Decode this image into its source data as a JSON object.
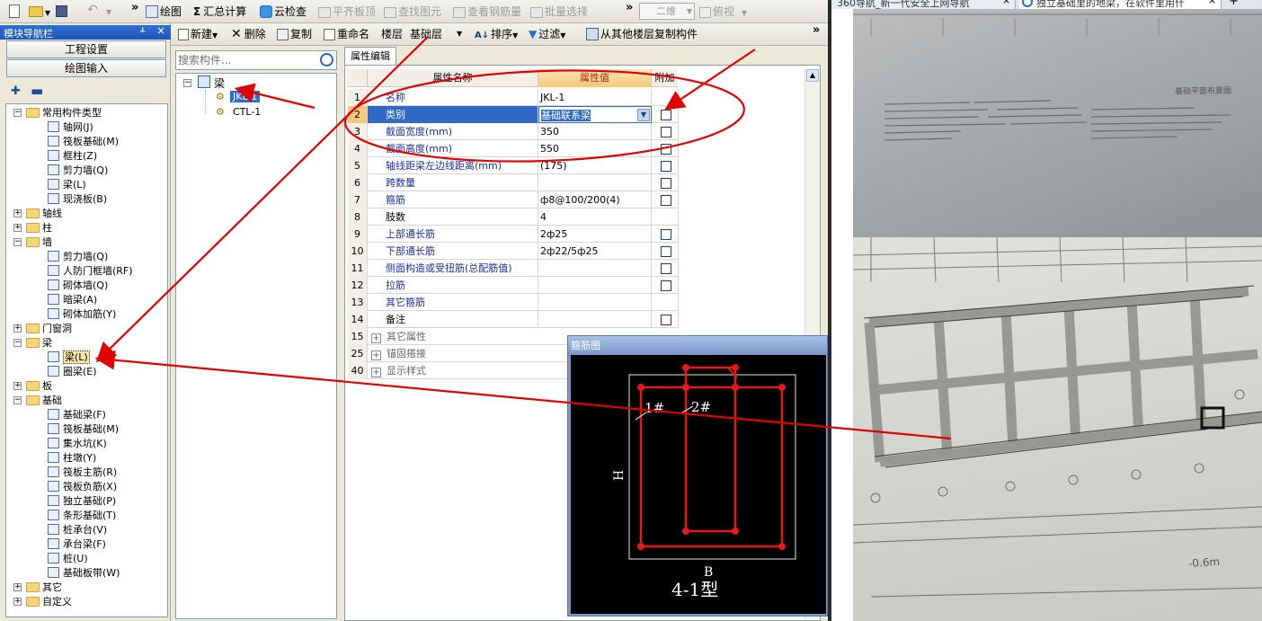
{
  "toolbar1": {
    "draw": "绘图",
    "sum": "汇总计算",
    "cloud_check": "云检查",
    "flat_top": "平齐板顶",
    "find": "查找图元",
    "view_rebar": "查看钢筋量",
    "batch": "批量选择",
    "view_mode": "二维",
    "perspective": "俯视",
    "chevron": "»"
  },
  "nav": {
    "title": "模块导航栏",
    "project_settings": "工程设置",
    "draw_input": "绘图输入",
    "tree": [
      {
        "label": "常用构件类型",
        "type": "folder",
        "expanded": true,
        "level": 0
      },
      {
        "label": "轴网(J)",
        "type": "item",
        "level": 1
      },
      {
        "label": "筏板基础(M)",
        "type": "item",
        "level": 1
      },
      {
        "label": "框柱(Z)",
        "type": "item",
        "level": 1
      },
      {
        "label": "剪力墙(Q)",
        "type": "item",
        "level": 1
      },
      {
        "label": "梁(L)",
        "type": "item",
        "level": 1
      },
      {
        "label": "现浇板(B)",
        "type": "item",
        "level": 1
      },
      {
        "label": "轴线",
        "type": "folder",
        "expanded": false,
        "level": 0
      },
      {
        "label": "柱",
        "type": "folder",
        "expanded": false,
        "level": 0
      },
      {
        "label": "墙",
        "type": "folder",
        "expanded": true,
        "level": 0
      },
      {
        "label": "剪力墙(Q)",
        "type": "item",
        "level": 1
      },
      {
        "label": "人防门框墙(RF)",
        "type": "item",
        "level": 1
      },
      {
        "label": "砌体墙(Q)",
        "type": "item",
        "level": 1
      },
      {
        "label": "暗梁(A)",
        "type": "item",
        "level": 1
      },
      {
        "label": "砌体加筋(Y)",
        "type": "item",
        "level": 1
      },
      {
        "label": "门窗洞",
        "type": "folder",
        "expanded": false,
        "level": 0
      },
      {
        "label": "梁",
        "type": "folder",
        "expanded": true,
        "level": 0
      },
      {
        "label": "梁(L)",
        "type": "item",
        "level": 1,
        "selected": true
      },
      {
        "label": "圈梁(E)",
        "type": "item",
        "level": 1
      },
      {
        "label": "板",
        "type": "folder",
        "expanded": false,
        "level": 0
      },
      {
        "label": "基础",
        "type": "folder",
        "expanded": true,
        "level": 0
      },
      {
        "label": "基础梁(F)",
        "type": "item",
        "level": 1
      },
      {
        "label": "筏板基础(M)",
        "type": "item",
        "level": 1
      },
      {
        "label": "集水坑(K)",
        "type": "item",
        "level": 1
      },
      {
        "label": "柱墩(Y)",
        "type": "item",
        "level": 1
      },
      {
        "label": "筏板主筋(R)",
        "type": "item",
        "level": 1
      },
      {
        "label": "筏板负筋(X)",
        "type": "item",
        "level": 1
      },
      {
        "label": "独立基础(P)",
        "type": "item",
        "level": 1
      },
      {
        "label": "条形基础(T)",
        "type": "item",
        "level": 1
      },
      {
        "label": "桩承台(V)",
        "type": "item",
        "level": 1
      },
      {
        "label": "承台梁(F)",
        "type": "item",
        "level": 1
      },
      {
        "label": "桩(U)",
        "type": "item",
        "level": 1
      },
      {
        "label": "基础板带(W)",
        "type": "item",
        "level": 1
      },
      {
        "label": "其它",
        "type": "folder",
        "expanded": false,
        "level": 0
      },
      {
        "label": "自定义",
        "type": "folder",
        "expanded": false,
        "level": 0
      }
    ]
  },
  "toolbar2": {
    "new": "新建",
    "delete": "删除",
    "copy": "复制",
    "rename": "重命名",
    "floor_label": "楼层",
    "floor_value": "基础层",
    "sort": "排序",
    "filter": "过滤",
    "copy_from_floor": "从其他楼层复制构件",
    "chevron": "»"
  },
  "component_list": {
    "search_placeholder": "搜索构件...",
    "root": "梁",
    "items": [
      "JKL-1",
      "CTL-1"
    ]
  },
  "property_editor": {
    "tab": "属性编辑",
    "col_name": "属性名称",
    "col_value": "属性值",
    "col_extra": "附加",
    "rows": [
      {
        "no": "1",
        "name": "名称",
        "value": "JKL-1",
        "check": false
      },
      {
        "no": "2",
        "name": "类别",
        "value": "基础联系梁",
        "check": true
      },
      {
        "no": "3",
        "name": "截面宽度(mm)",
        "value": "350",
        "check": true
      },
      {
        "no": "4",
        "name": "截面高度(mm)",
        "value": "550",
        "check": true
      },
      {
        "no": "5",
        "name": "轴线距梁左边线距离(mm)",
        "value": "(175)",
        "check": true
      },
      {
        "no": "6",
        "name": "跨数量",
        "value": "",
        "check": true
      },
      {
        "no": "7",
        "name": "箍筋",
        "value": "ф8@100/200(4)",
        "check": true
      },
      {
        "no": "8",
        "name": "肢数",
        "value": "4",
        "check": false
      },
      {
        "no": "9",
        "name": "上部通长筋",
        "value": "2ф25",
        "check": true
      },
      {
        "no": "10",
        "name": "下部通长筋",
        "value": "2ф22/5ф25",
        "check": true
      },
      {
        "no": "11",
        "name": "侧面构造或受扭筋(总配筋值)",
        "value": "",
        "check": true
      },
      {
        "no": "12",
        "name": "拉筋",
        "value": "",
        "check": true
      },
      {
        "no": "13",
        "name": "其它箍筋",
        "value": "",
        "check": false
      },
      {
        "no": "14",
        "name": "备注",
        "value": "",
        "check": true
      },
      {
        "no": "15",
        "name": "其它属性",
        "value": "",
        "group": true
      },
      {
        "no": "25",
        "name": "锚固搭接",
        "value": "",
        "group": true
      },
      {
        "no": "40",
        "name": "显示样式",
        "value": "",
        "group": true
      }
    ]
  },
  "stirrup_popup": {
    "title": "箍筋图",
    "label1": "1#",
    "label2": "2#",
    "h_label": "H",
    "b_label": "B",
    "type_label": "4-1型"
  },
  "browser": {
    "tab1": "360导航_新一代安全上网导航",
    "tab2": "独立基础里的地梁，在软件里用什",
    "close": "×",
    "plus": "+"
  },
  "photo": {
    "caption": "基础平面布置图",
    "dim_text": "-0.6m"
  },
  "colors": {
    "annotation_red": "#e00000",
    "selection_blue": "#316ac5",
    "nav_title_blue": "#2563c7"
  }
}
